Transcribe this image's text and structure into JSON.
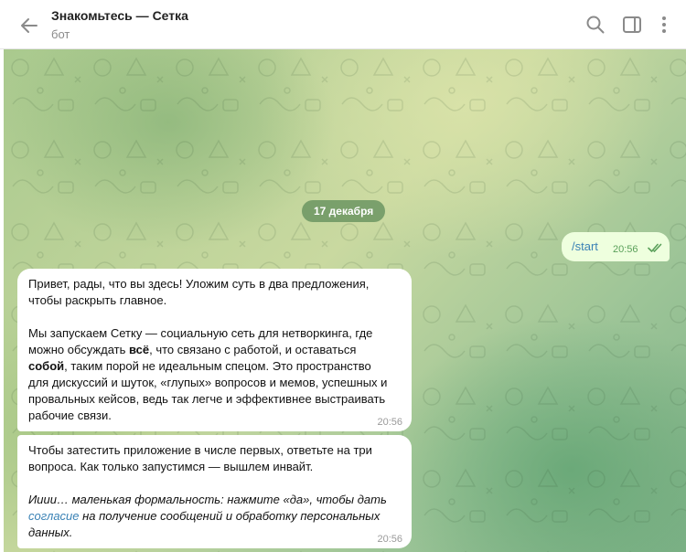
{
  "header": {
    "title": "Знакомьтесь — Сетка",
    "subtitle": "бот"
  },
  "chat": {
    "date_badge": "17 декабря",
    "outgoing": {
      "text": "/start",
      "time": "20:56"
    },
    "message1": {
      "p1_l1": "Привет, рады, что вы здесь! Уложим суть в два предложения,",
      "p1_l2": "чтобы раскрыть главное.",
      "p2_l1": "Мы запускаем Сетку — социальную сеть для нетворкинга, где",
      "p2_l2_a": "можно обсуждать ",
      "p2_l2_b": "всё",
      "p2_l2_c": ", что связано с работой, и оставаться",
      "p2_l3_a": "собой",
      "p2_l3_b": ", таким порой не идеальным спецом. Это пространство",
      "p2_l4": "для дискуссий и шуток, «глупых» вопросов и мемов, успешных и",
      "p2_l5": "провальных кейсов, ведь так легче и эффективнее выстраивать",
      "p2_l6": "рабочие связи.",
      "time": "20:56"
    },
    "message2": {
      "p1_l1": "Чтобы затестить приложение в числе первых, ответьте на три",
      "p1_l2": "вопроса. Как только запустимся — вышлем инвайт.",
      "p2_l1": "Ииии… маленькая формальность: нажмите «да», чтобы дать",
      "p2_l2_link": "согласие",
      "p2_l2_rest": " на получение сообщений и обработку персональных",
      "p2_l3": "данных.",
      "time": "20:56"
    }
  },
  "colors": {
    "accent": "#3a82b5",
    "outgoing_bubble": "#eeffde",
    "check": "#5aa05a"
  },
  "icons": [
    "back-arrow-icon",
    "search-icon",
    "sidebar-toggle-icon",
    "more-vertical-icon",
    "double-check-icon"
  ]
}
